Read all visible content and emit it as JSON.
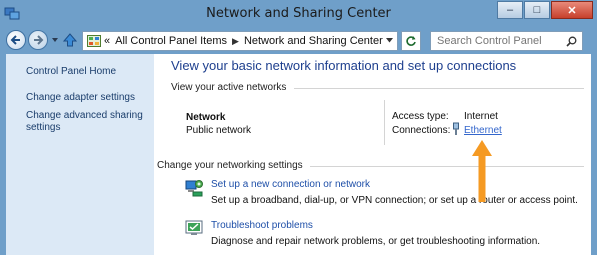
{
  "window": {
    "title": "Network and Sharing Center",
    "caption_buttons": {
      "minimize": "–",
      "maximize": "□",
      "close": "✕"
    }
  },
  "nav": {
    "address_segments": [
      "All Control Panel Items",
      "Network and Sharing Center"
    ],
    "address_prefix": "«",
    "address_separator": "▶",
    "search_placeholder": "Search Control Panel"
  },
  "sidebar": {
    "items": [
      {
        "label": "Control Panel Home"
      },
      {
        "label": "Change adapter settings"
      },
      {
        "label": "Change advanced sharing settings"
      }
    ]
  },
  "main": {
    "heading": "View your basic network information and set up connections",
    "active_networks_label": "View your active networks",
    "network": {
      "name": "Network",
      "type": "Public network",
      "access_type_label": "Access type:",
      "access_type_value": "Internet",
      "connections_label": "Connections:",
      "connection_link": "Ethernet"
    },
    "change_settings_label": "Change your networking settings",
    "tasks": [
      {
        "icon": "new-connection-icon",
        "link": "Set up a new connection or network",
        "description": "Set up a broadband, dial-up, or VPN connection; or set up a router or access point."
      },
      {
        "icon": "troubleshoot-icon",
        "link": "Troubleshoot problems",
        "description": "Diagnose and repair network problems, or get troubleshooting information."
      }
    ]
  },
  "colors": {
    "frame": "#6f9fc9",
    "sidebar": "#dce9f6",
    "heading": "#1e3f8e",
    "link": "#1e4fa8",
    "arrow": "#f59a23"
  }
}
